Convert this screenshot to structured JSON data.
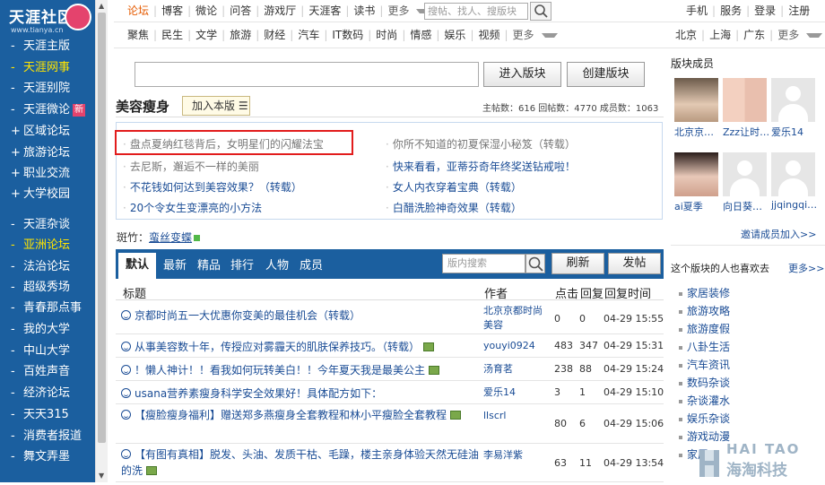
{
  "sidebar": {
    "logo_text": "天涯社区",
    "logo_url": "www.tianya.cn",
    "items": [
      {
        "label": "天涯主版"
      },
      {
        "label": "天涯网事"
      },
      {
        "label": "天涯别院"
      },
      {
        "label": "天涯微论",
        "badge": "新"
      },
      {
        "label": "区域论坛"
      },
      {
        "label": "旅游论坛"
      },
      {
        "label": "职业交流"
      },
      {
        "label": "大学校园"
      },
      {
        "label": "天涯杂谈"
      },
      {
        "label": "亚洲论坛"
      },
      {
        "label": "法治论坛"
      },
      {
        "label": "超级秀场"
      },
      {
        "label": "青春那点事"
      },
      {
        "label": "我的大学"
      },
      {
        "label": "中山大学"
      },
      {
        "label": "百姓声音"
      },
      {
        "label": "经济论坛"
      },
      {
        "label": "天天315"
      },
      {
        "label": "消费者报道"
      },
      {
        "label": "舞文弄墨"
      }
    ]
  },
  "topnav": {
    "row1": [
      "论坛",
      "博客",
      "微论",
      "问答",
      "游戏厅",
      "天涯客",
      "读书"
    ],
    "row1_more": "更多",
    "search_placeholder": "搜帖、找人、搜版块",
    "row1_right": [
      "手机",
      "服务",
      "登录",
      "注册"
    ],
    "row2": [
      "聚焦",
      "民生",
      "文学",
      "旅游",
      "财经",
      "汽车",
      "IT数码",
      "时尚",
      "情感",
      "娱乐",
      "视频"
    ],
    "row2_more": "更多",
    "row2_right": [
      "北京",
      "上海",
      "广东"
    ],
    "row2_right_more": "更多"
  },
  "forum": {
    "enter_btn": "进入版块",
    "create_btn": "创建版块",
    "title": "美容瘦身",
    "join_btn": "加入本版",
    "stats": "主帖数：616  回帖数：4770  成员数：1063",
    "recommend": [
      "盘点夏纳红毯背后，女明星们的闪耀法宝",
      "你所不知道的初夏保湿小秘笈（转载）",
      "去尼斯，邂逅不一样的美丽",
      "快来看看，亚蒂芬奇年终奖送钻戒啦！",
      "不花钱如何达到美容效果？（转载）",
      "女人内衣穿着宝典（转载）",
      "20个令女生变漂亮的小方法",
      "白醋洗脸神奇效果（转载）"
    ],
    "moderator_label": "斑竹：",
    "moderator_name": "蛮丝变蝶",
    "tabs": [
      "默认",
      "最新",
      "精品",
      "排行",
      "人物",
      "成员"
    ],
    "inner_search_placeholder": "版内搜索",
    "refresh_btn": "刷新",
    "post_btn": "发帖",
    "headers": {
      "title": "标题",
      "author": "作者",
      "clicks": "点击",
      "replies": "回复",
      "reply_time": "回复时间"
    },
    "rows": [
      {
        "title": "京都时尚五一大优惠你变美的最佳机会（转载）",
        "author": "北京京都时尚美容",
        "clicks": "0",
        "replies": "0",
        "time": "04-29 15:55",
        "img": false
      },
      {
        "title": "从事美容数十年，传授应对雾霾天的肌肤保养技巧。（转载）",
        "author": "youyi0924",
        "clicks": "483",
        "replies": "347",
        "time": "04-29 15:31",
        "img": true
      },
      {
        "title": "！懒人神计！！看我如何玩转美白！！今年夏天我是最美公主",
        "author": "汤育茗",
        "clicks": "238",
        "replies": "88",
        "time": "04-29 15:24",
        "img": true
      },
      {
        "title": "usana营养素瘦身科学安全效果好！具体配方如下：",
        "author": "爱乐14",
        "clicks": "3",
        "replies": "1",
        "time": "04-29 15:10",
        "img": false
      },
      {
        "title": "【瘦脸瘦身福利】赠送郑多燕瘦身全套教程和林小平瘦脸全套教程",
        "author": "llscrl",
        "clicks": "80",
        "replies": "6",
        "time": "04-29 15:06",
        "img": true
      },
      {
        "title": "【有图有真相】脱发、头油、发质干枯、毛躁，楼主亲身体验天然无硅油的洗",
        "author": "李易洋紫",
        "clicks": "63",
        "replies": "11",
        "time": "04-29 13:54",
        "img": true
      }
    ]
  },
  "right": {
    "members_title": "版块成员",
    "members": [
      {
        "name": "北京京…"
      },
      {
        "name": "Zzz让时…"
      },
      {
        "name": "爱乐14"
      },
      {
        "name": "ai夏季"
      },
      {
        "name": "向日葵…"
      },
      {
        "name": "jjqingqi…"
      }
    ],
    "invite": "邀请成员加入>>",
    "also_like": "这个版块的人也喜欢去",
    "more": "更多>>",
    "links": [
      "家居装修",
      "旅游攻略",
      "旅游度假",
      "八卦生活",
      "汽车资讯",
      "数码杂谈",
      "杂谈灌水",
      "娱乐杂谈",
      "游戏动漫",
      "家居"
    ]
  },
  "watermark": {
    "text1": "HAI TAO",
    "text2": "海淘科技"
  }
}
